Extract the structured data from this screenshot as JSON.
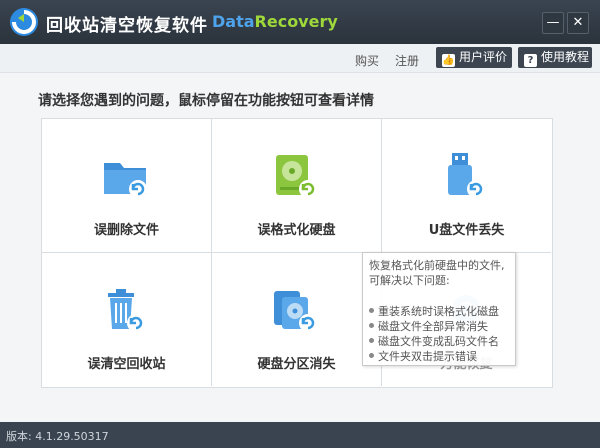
{
  "window": {
    "title": "回收站清空恢复软件",
    "brand_part1": "Data",
    "brand_part2": "Recovery",
    "minimize_label": "—",
    "close_label": "✕"
  },
  "toolbar": {
    "buy_label": "购买",
    "register_label": "注册",
    "review_label": "用户评价",
    "tutorial_label": "使用教程"
  },
  "prompt": "请选择您遇到的问题，鼠标停留在功能按钮可查看详情",
  "options": [
    {
      "label": "误删除文件",
      "icon": "folder-restore-icon"
    },
    {
      "label": "误格式化硬盘",
      "icon": "hard-drive-restore-icon"
    },
    {
      "label": "U盘文件丢失",
      "icon": "usb-drive-restore-icon"
    },
    {
      "label": "误清空回收站",
      "icon": "recycle-bin-restore-icon"
    },
    {
      "label": "硬盘分区消失",
      "icon": "partition-restore-icon"
    },
    {
      "label": "万能恢复",
      "icon": "universal-restore-icon"
    }
  ],
  "tooltip": {
    "line1": "恢复格式化前硬盘中的文件,",
    "line2": "可解决以下问题:",
    "items": [
      "重装系统时误格式化磁盘",
      "磁盘文件全部异常消失",
      "磁盘文件变成乱码文件名",
      "文件夹双击提示错误"
    ]
  },
  "status": {
    "version": "版本: 4.1.29.50317"
  },
  "colors": {
    "accent_blue": "#4fa3ea",
    "accent_green": "#9ed83a",
    "titlebar": "#2b333c"
  }
}
